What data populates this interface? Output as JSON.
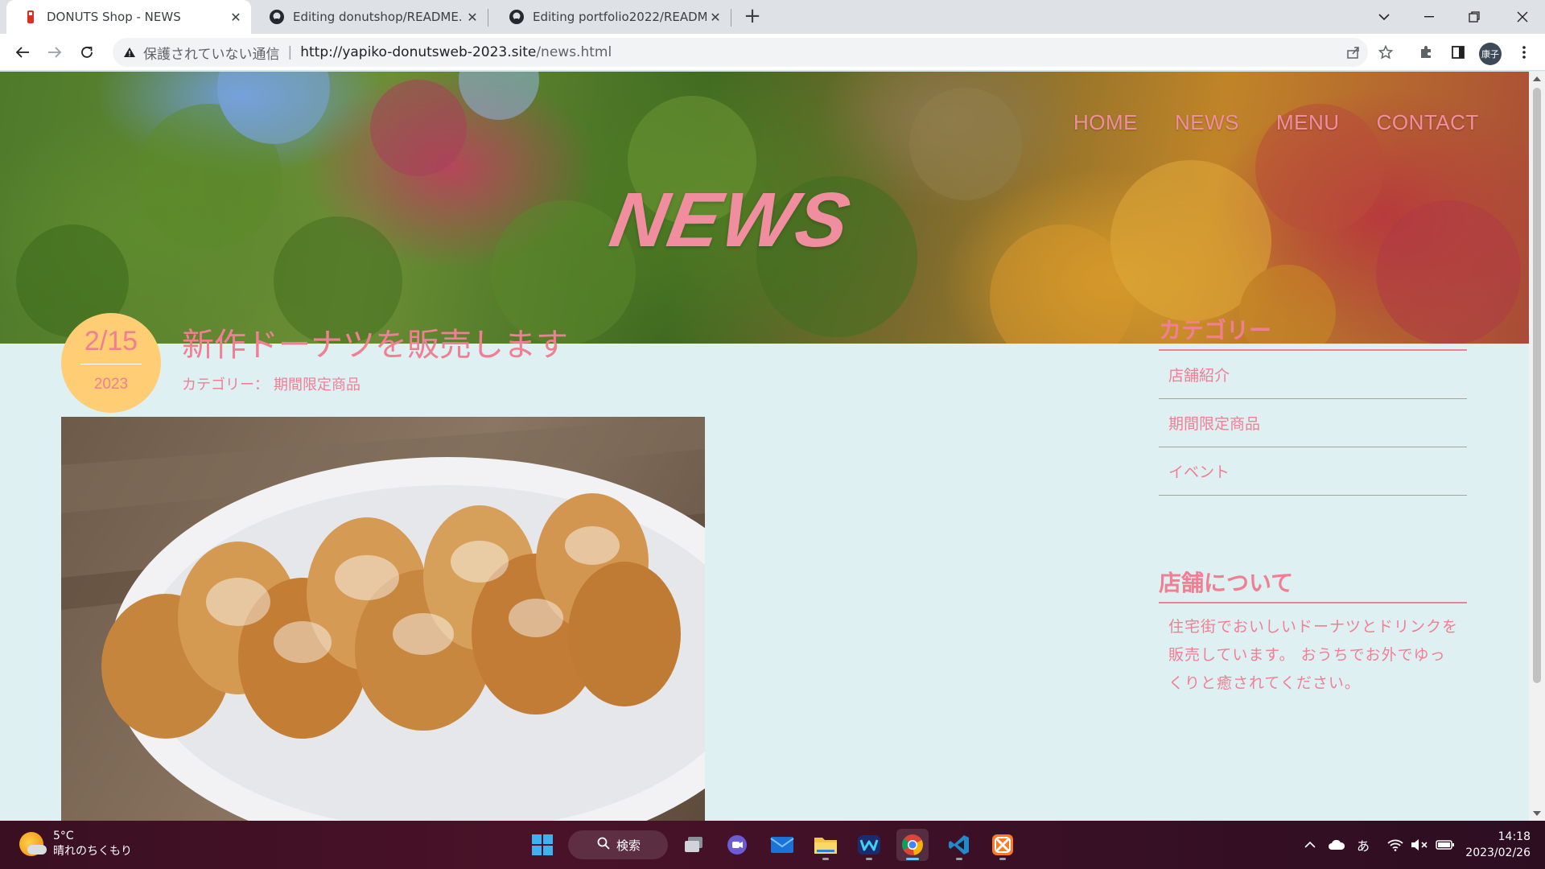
{
  "browser": {
    "tabs": [
      {
        "title": "DONUTS Shop - NEWS",
        "active": true
      },
      {
        "title": "Editing donutshop/README.md",
        "active": false
      },
      {
        "title": "Editing portfolio2022/README.m",
        "active": false
      }
    ],
    "new_tab": "+",
    "address": {
      "security_label": "保護されていない通信",
      "host": "http://yapiko-donutsweb-2023.site",
      "path": "/news.html"
    },
    "profile_initials": "康子"
  },
  "site": {
    "nav": [
      "HOME",
      "NEWS",
      "MENU",
      "CONTACT"
    ],
    "hero_title": "NEWS",
    "post": {
      "date_md": "2/15",
      "date_year": "2023",
      "title": "新作ドーナツを販売します",
      "category_label": "カテゴリー：",
      "category": "期間限定商品"
    },
    "sidebar": {
      "categories_heading": "カテゴリー",
      "categories": [
        "店舗紹介",
        "期間限定商品",
        "イベント"
      ],
      "about_heading": "店舗について",
      "about_text": "住宅街でおいしいドーナツとドリンクを販売しています。 おうちでお外でゆっくりと癒されてください。"
    }
  },
  "taskbar": {
    "weather_temp": "5°C",
    "weather_desc": "晴れのちくもり",
    "search_label": "検索",
    "ime": "あ",
    "time": "14:18",
    "date": "2023/02/26"
  },
  "colors": {
    "accent_pink": "#f07f93",
    "date_circle": "#ffcd74",
    "page_bg": "#dff0f3"
  }
}
